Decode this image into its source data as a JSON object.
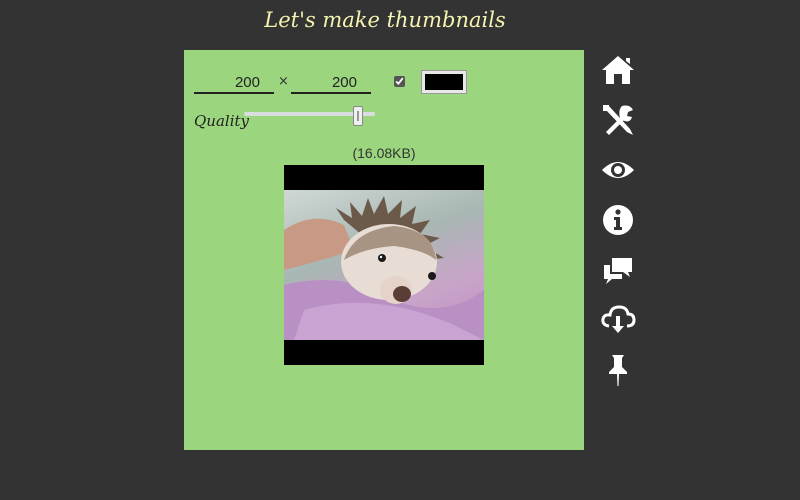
{
  "app": {
    "title": "Let's make thumbnails"
  },
  "controls": {
    "width_value": "200",
    "height_value": "200",
    "times_symbol": "×",
    "keep_ratio_checked": true,
    "background_color": "#000000",
    "quality_label": "Quality",
    "quality_fraction": 0.9
  },
  "preview": {
    "file_size": "(16.08KB)"
  },
  "sidebar": {
    "icons": [
      "home-icon",
      "tools-icon",
      "eye-icon",
      "info-icon",
      "comments-icon",
      "cloud-download-icon",
      "pin-icon"
    ]
  },
  "colors": {
    "page_bg": "#333333",
    "panel_bg": "#9bd67e",
    "title": "#f4f3b0",
    "icon": "#ffffff"
  }
}
